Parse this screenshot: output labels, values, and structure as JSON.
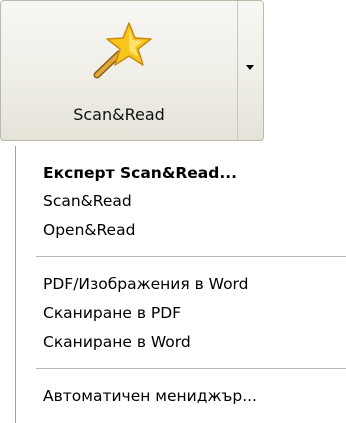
{
  "button": {
    "label": "Scan&Read",
    "icon": "magic-wand-star-icon",
    "dropdown_icon": "dropdown-arrow-icon"
  },
  "menu": {
    "group1": [
      "Експерт Scan&Read...",
      "Scan&Read",
      "Open&Read"
    ],
    "group2": [
      "PDF/Изображения в Word",
      "Сканиране в PDF",
      "Сканиране в Word"
    ],
    "group3": [
      "Автоматичен мениджър..."
    ]
  },
  "colors": {
    "star_fill": "#f5c21b",
    "wand": "#d9a13a",
    "border": "#b7b9ab"
  }
}
